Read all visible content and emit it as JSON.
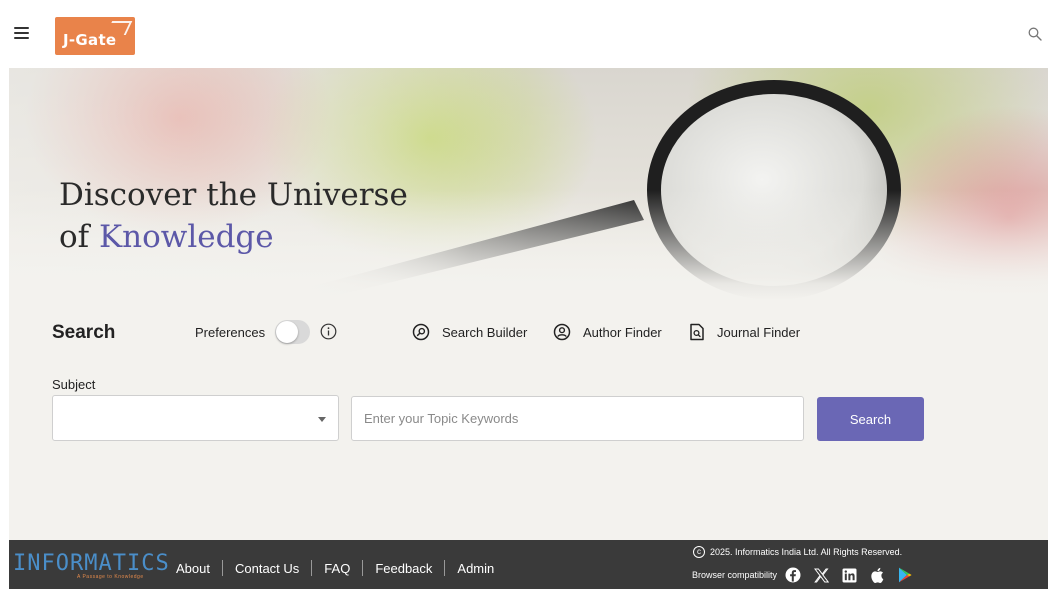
{
  "header": {
    "logo_text": "J-Gate",
    "logo_color": "#e9834a"
  },
  "hero": {
    "title_line1": "Discover the Universe",
    "title_line2_prefix": "of ",
    "title_line2_accent": "Knowledge",
    "accent_color": "#5c58a8"
  },
  "search": {
    "heading": "Search",
    "preferences_label": "Preferences",
    "preferences_on": false,
    "tools": [
      {
        "label": "Search Builder",
        "icon": "search-builder-icon"
      },
      {
        "label": "Author Finder",
        "icon": "author-icon"
      },
      {
        "label": "Journal Finder",
        "icon": "journal-icon"
      }
    ],
    "subject_label": "Subject",
    "subject_value": "",
    "topic_placeholder": "Enter your Topic Keywords",
    "topic_value": "",
    "button_label": "Search",
    "button_color": "#6a67b5"
  },
  "footer": {
    "brand": "INFORMATICS",
    "brand_tagline": "A Passage to Knowledge",
    "nav": [
      "About",
      "Contact Us",
      "FAQ",
      "Feedback",
      "Admin"
    ],
    "copyright": "2025. Informatics India Ltd. All Rights Reserved.",
    "compat_label": "Browser compatibility",
    "social_icons": [
      "facebook-icon",
      "x-icon",
      "linkedin-icon",
      "apple-icon",
      "play-store-icon"
    ]
  }
}
